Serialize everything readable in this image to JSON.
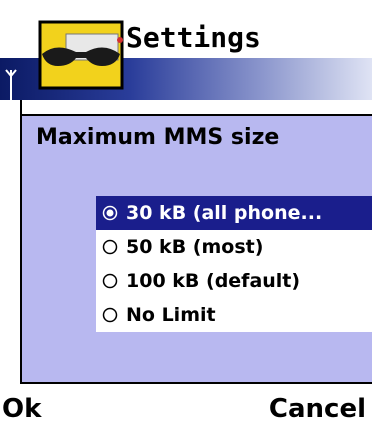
{
  "header": {
    "title": "Settings",
    "app_icon": "sunglasses-icon",
    "signal_icon": "signal-antenna-icon"
  },
  "dialog": {
    "heading": "Maximum MMS size",
    "options": [
      {
        "label": "30 kB (all phone...",
        "selected": true
      },
      {
        "label": "50 kB (most)",
        "selected": false
      },
      {
        "label": "100 kB (default)",
        "selected": false
      },
      {
        "label": "No Limit",
        "selected": false
      }
    ]
  },
  "softkeys": {
    "left": "Ok",
    "right": "Cancel"
  },
  "colors": {
    "dialog_bg": "#b8b8f0",
    "selection_bg": "#1a1e8c",
    "header_gradient_dark": "#0b1a64",
    "header_gradient_light": "#dfe3f4",
    "icon_yellow": "#f2d21c"
  }
}
